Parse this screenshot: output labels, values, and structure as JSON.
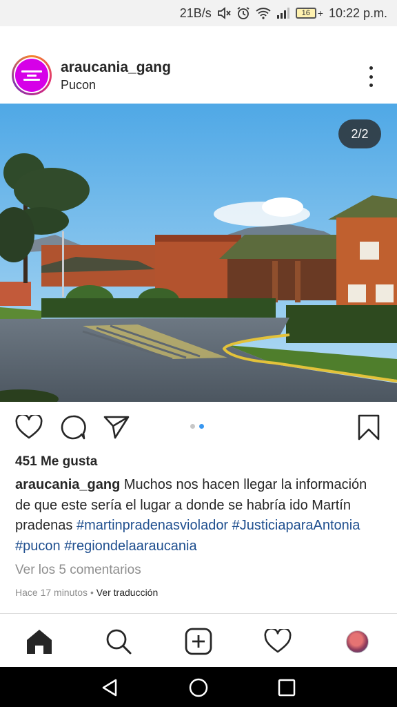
{
  "status_bar": {
    "net_speed": "21B/s",
    "battery": "16",
    "battery_plus": "+",
    "time": "10:22 p.m.",
    "icons": [
      "mute-icon",
      "alarm-icon",
      "wifi-icon",
      "signal-icon",
      "battery-icon"
    ]
  },
  "post": {
    "username": "araucania_gang",
    "location": "Pucon",
    "image_counter": "2/2",
    "carousel": {
      "count": 2,
      "active_index": 1
    },
    "likes": "451 Me gusta",
    "caption_user": "araucania_gang",
    "caption_text": " Muchos nos hacen llegar la información de que este sería el lugar a donde se habría ido Martín pradenas ",
    "hashtags": [
      "#martinpradenasviolador",
      "#JusticiaparaAntonia",
      "#pucon",
      "#regiondelaaraucania"
    ],
    "view_comments": "Ver los 5 comentarios",
    "time_ago": "Hace 17 minutos",
    "separator": " • ",
    "translate": "Ver traducción"
  },
  "colors": {
    "accent_blue": "#3897f0",
    "hashtag": "#1f4f8f",
    "avatar_bg": "#d600e8",
    "muted": "#8e8e8e"
  },
  "tabbar": {
    "items": [
      "home-icon",
      "search-icon",
      "new-post-icon",
      "activity-icon",
      "profile-avatar"
    ],
    "active": "home-icon"
  },
  "navbar": {
    "items": [
      "back-icon",
      "home-circle-icon",
      "recents-icon"
    ]
  }
}
